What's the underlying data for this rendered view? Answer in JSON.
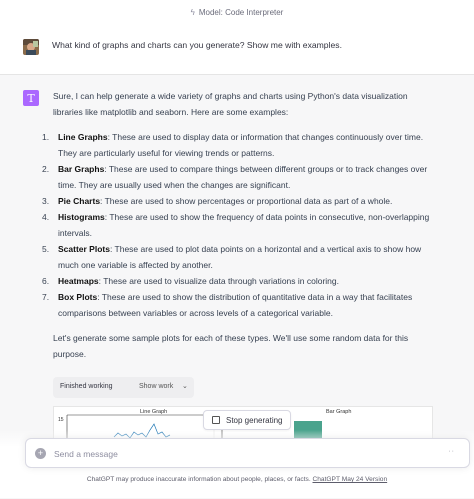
{
  "topbar": {
    "model_label": "Model: Code Interpreter",
    "icon": "bolt-icon"
  },
  "user_message": {
    "text": "What kind of graphs and charts can you generate? Show me with examples."
  },
  "assistant": {
    "avatar_glyph": "T",
    "intro": "Sure, I can help generate a wide variety of graphs and charts using Python's data visualization libraries like matplotlib and seaborn. Here are some examples:",
    "items": [
      {
        "num": "1.",
        "term": "Line Graphs",
        "desc": ": These are used to display data or information that changes continuously over time. They are particularly useful for viewing trends or patterns."
      },
      {
        "num": "2.",
        "term": "Bar Graphs",
        "desc": ": These are used to compare things between different groups or to track changes over time. They are usually used when the changes are significant."
      },
      {
        "num": "3.",
        "term": "Pie Charts",
        "desc": ": These are used to show percentages or proportional data as part of a whole."
      },
      {
        "num": "4.",
        "term": "Histograms",
        "desc": ": These are used to show the frequency of data points in consecutive, non-overlapping intervals."
      },
      {
        "num": "5.",
        "term": "Scatter Plots",
        "desc": ": These are used to plot data points on a horizontal and a vertical axis to show how much one variable is affected by another."
      },
      {
        "num": "6.",
        "term": "Heatmaps",
        "desc": ": These are used to visualize data through variations in coloring."
      },
      {
        "num": "7.",
        "term": "Box Plots",
        "desc": ": These are used to show the distribution of quantitative data in a way that facilitates comparisons between variables or across levels of a categorical variable."
      }
    ],
    "outro": "Let's generate some sample plots for each of these types. We'll use some random data for this purpose.",
    "working": {
      "status": "Finished working",
      "toggle": "Show work"
    },
    "plot_preview": {
      "left_title": "Line Graph",
      "right_title": "Bar Graph",
      "ytick": "15"
    }
  },
  "stop_button": {
    "label": "Stop generating"
  },
  "composer": {
    "placeholder": "Send a message",
    "plus_icon": "plus-circle-icon"
  },
  "footer": {
    "text": "ChatGPT may produce inaccurate information about people, places, or facts. ",
    "link": "ChatGPT May 24 Version"
  },
  "colors": {
    "bot_avatar": "#ab68ff",
    "background_alt": "#f7f7f8",
    "bar": "#4aa38d"
  }
}
